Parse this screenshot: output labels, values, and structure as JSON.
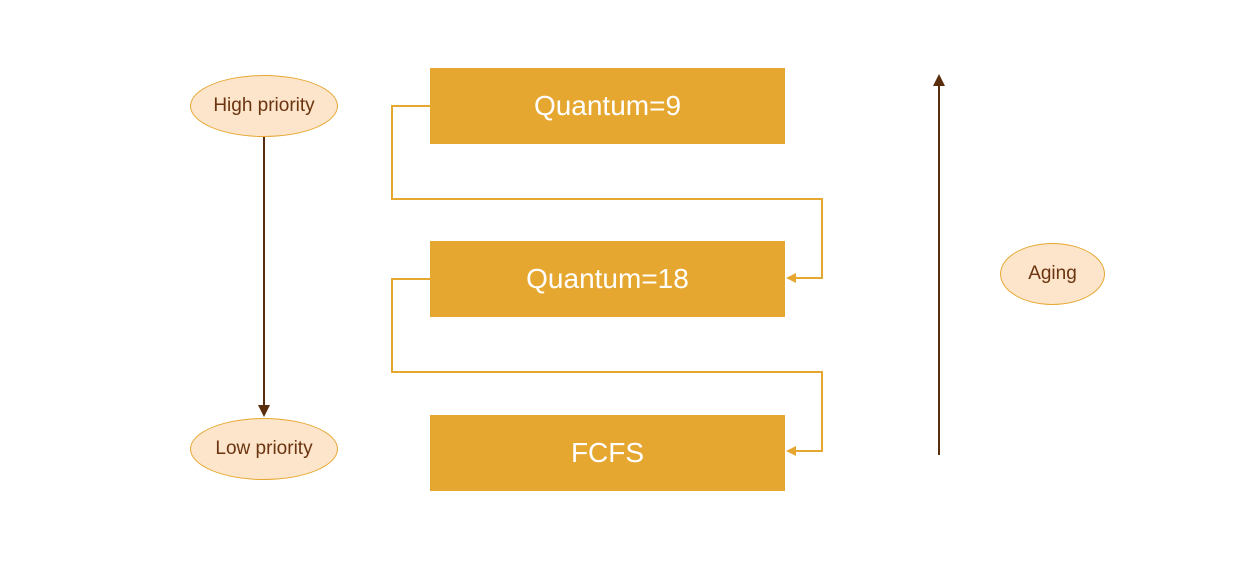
{
  "nodes": {
    "high_priority": "High priority",
    "low_priority": "Low priority",
    "aging": "Aging"
  },
  "queues": {
    "q1": "Quantum=9",
    "q2": "Quantum=18",
    "q3": "FCFS"
  }
}
